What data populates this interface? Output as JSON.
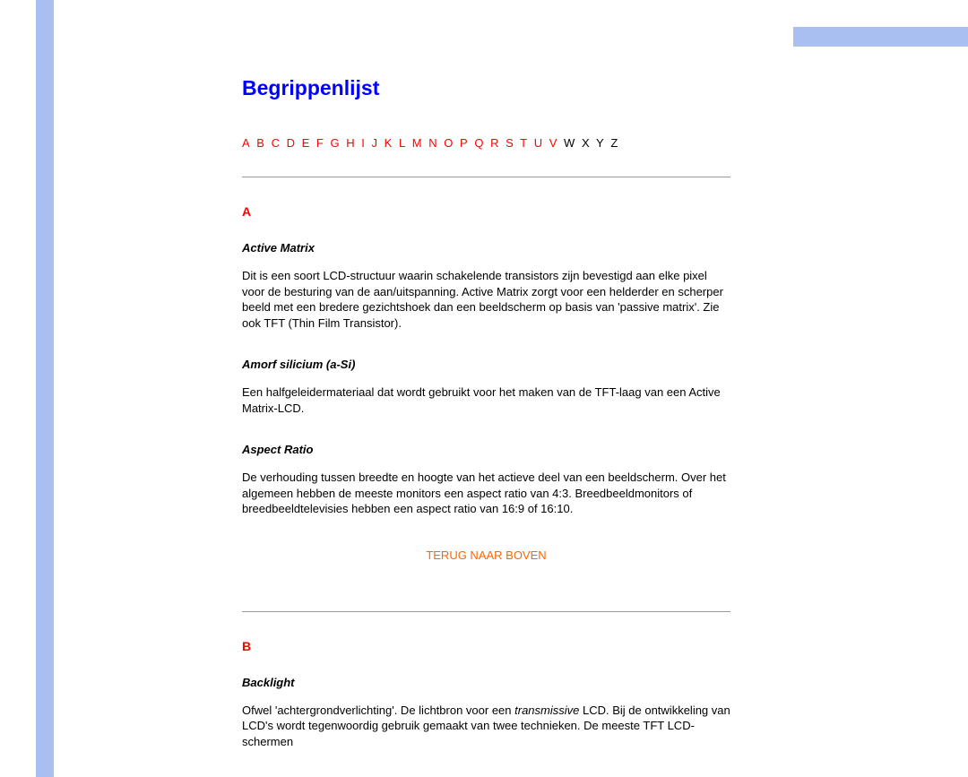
{
  "title": "Begrippenlijst",
  "alphaNav": {
    "links": [
      "A",
      "B",
      "C",
      "D",
      "E",
      "F",
      "G",
      "H",
      "I",
      "J",
      "K",
      "L",
      "M",
      "N",
      "O",
      "P",
      "Q",
      "R",
      "S",
      "T",
      "U",
      "V"
    ],
    "plain": [
      "W",
      "X",
      "Y",
      "Z"
    ]
  },
  "sectionA": {
    "letter": "A",
    "terms": [
      {
        "name": "Active Matrix",
        "desc": "Dit is een soort LCD-structuur waarin schakelende transistors zijn bevestigd aan elke pixel voor de besturing van de aan/uitspanning. Active Matrix zorgt voor een helderder en scherper beeld met een bredere gezichtshoek dan een beeldscherm op basis van 'passive matrix'. Zie ook TFT (Thin Film Transistor)."
      },
      {
        "name": "Amorf silicium (a-Si)",
        "desc": "Een halfgeleidermateriaal dat wordt gebruikt voor het maken van de TFT-laag van een Active Matrix-LCD."
      },
      {
        "name": "Aspect Ratio",
        "desc": "De verhouding tussen breedte en hoogte van het actieve deel van een beeldscherm. Over het algemeen hebben de meeste monitors een aspect ratio van 4:3. Breedbeeldmonitors of breedbeeldtelevisies hebben een aspect ratio van 16:9 of 16:10."
      }
    ]
  },
  "backToTop": "TERUG NAAR BOVEN",
  "sectionB": {
    "letter": "B",
    "terms": [
      {
        "name": "Backlight",
        "descPrefix": "Ofwel 'achtergrondverlichting'. De lichtbron voor een ",
        "descItalic": "transmissive",
        "descSuffix": " LCD. Bij de ontwikkeling van LCD's wordt tegenwoordig gebruik gemaakt van twee technieken. De meeste TFT LCD-schermen"
      }
    ]
  }
}
